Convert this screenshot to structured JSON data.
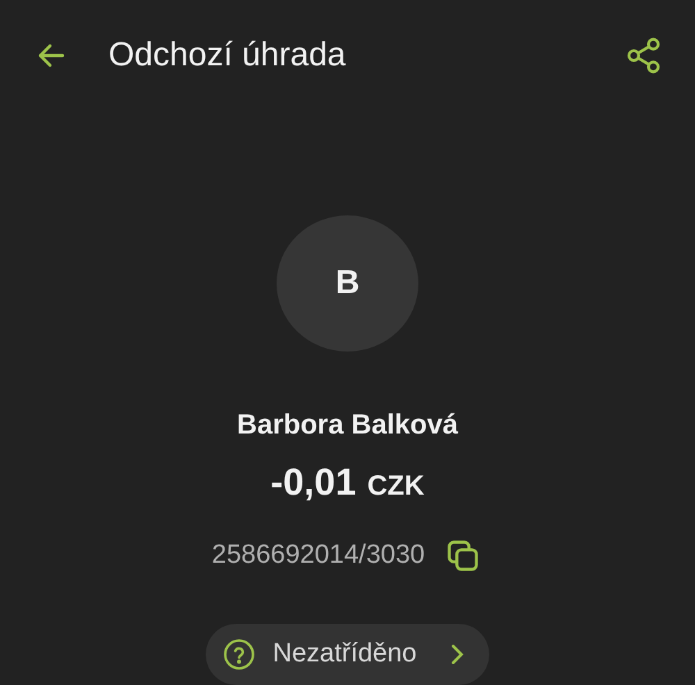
{
  "header": {
    "title": "Odchozí úhrada"
  },
  "payee": {
    "initial": "B",
    "name": "Barbora Balková",
    "amount": "-0,01",
    "currency": "CZK",
    "account": "2586692014/3030"
  },
  "category": {
    "label": "Nezatříděno"
  }
}
